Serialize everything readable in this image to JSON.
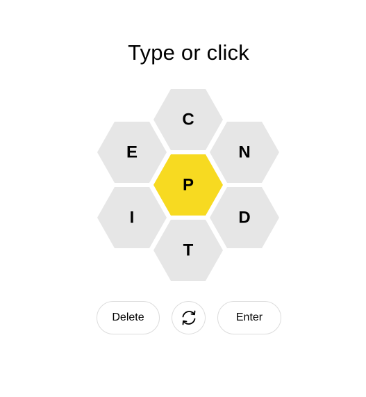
{
  "prompt": "Type or click",
  "hive": {
    "center_letter": "P",
    "outer_letters": [
      "C",
      "N",
      "D",
      "T",
      "I",
      "E"
    ]
  },
  "controls": {
    "delete_label": "Delete",
    "shuffle_icon": "shuffle-icon",
    "enter_label": "Enter"
  },
  "colors": {
    "center_cell": "#f7da21",
    "outer_cell": "#e6e6e6",
    "text": "#000000",
    "button_border": "#dcdcdc"
  }
}
